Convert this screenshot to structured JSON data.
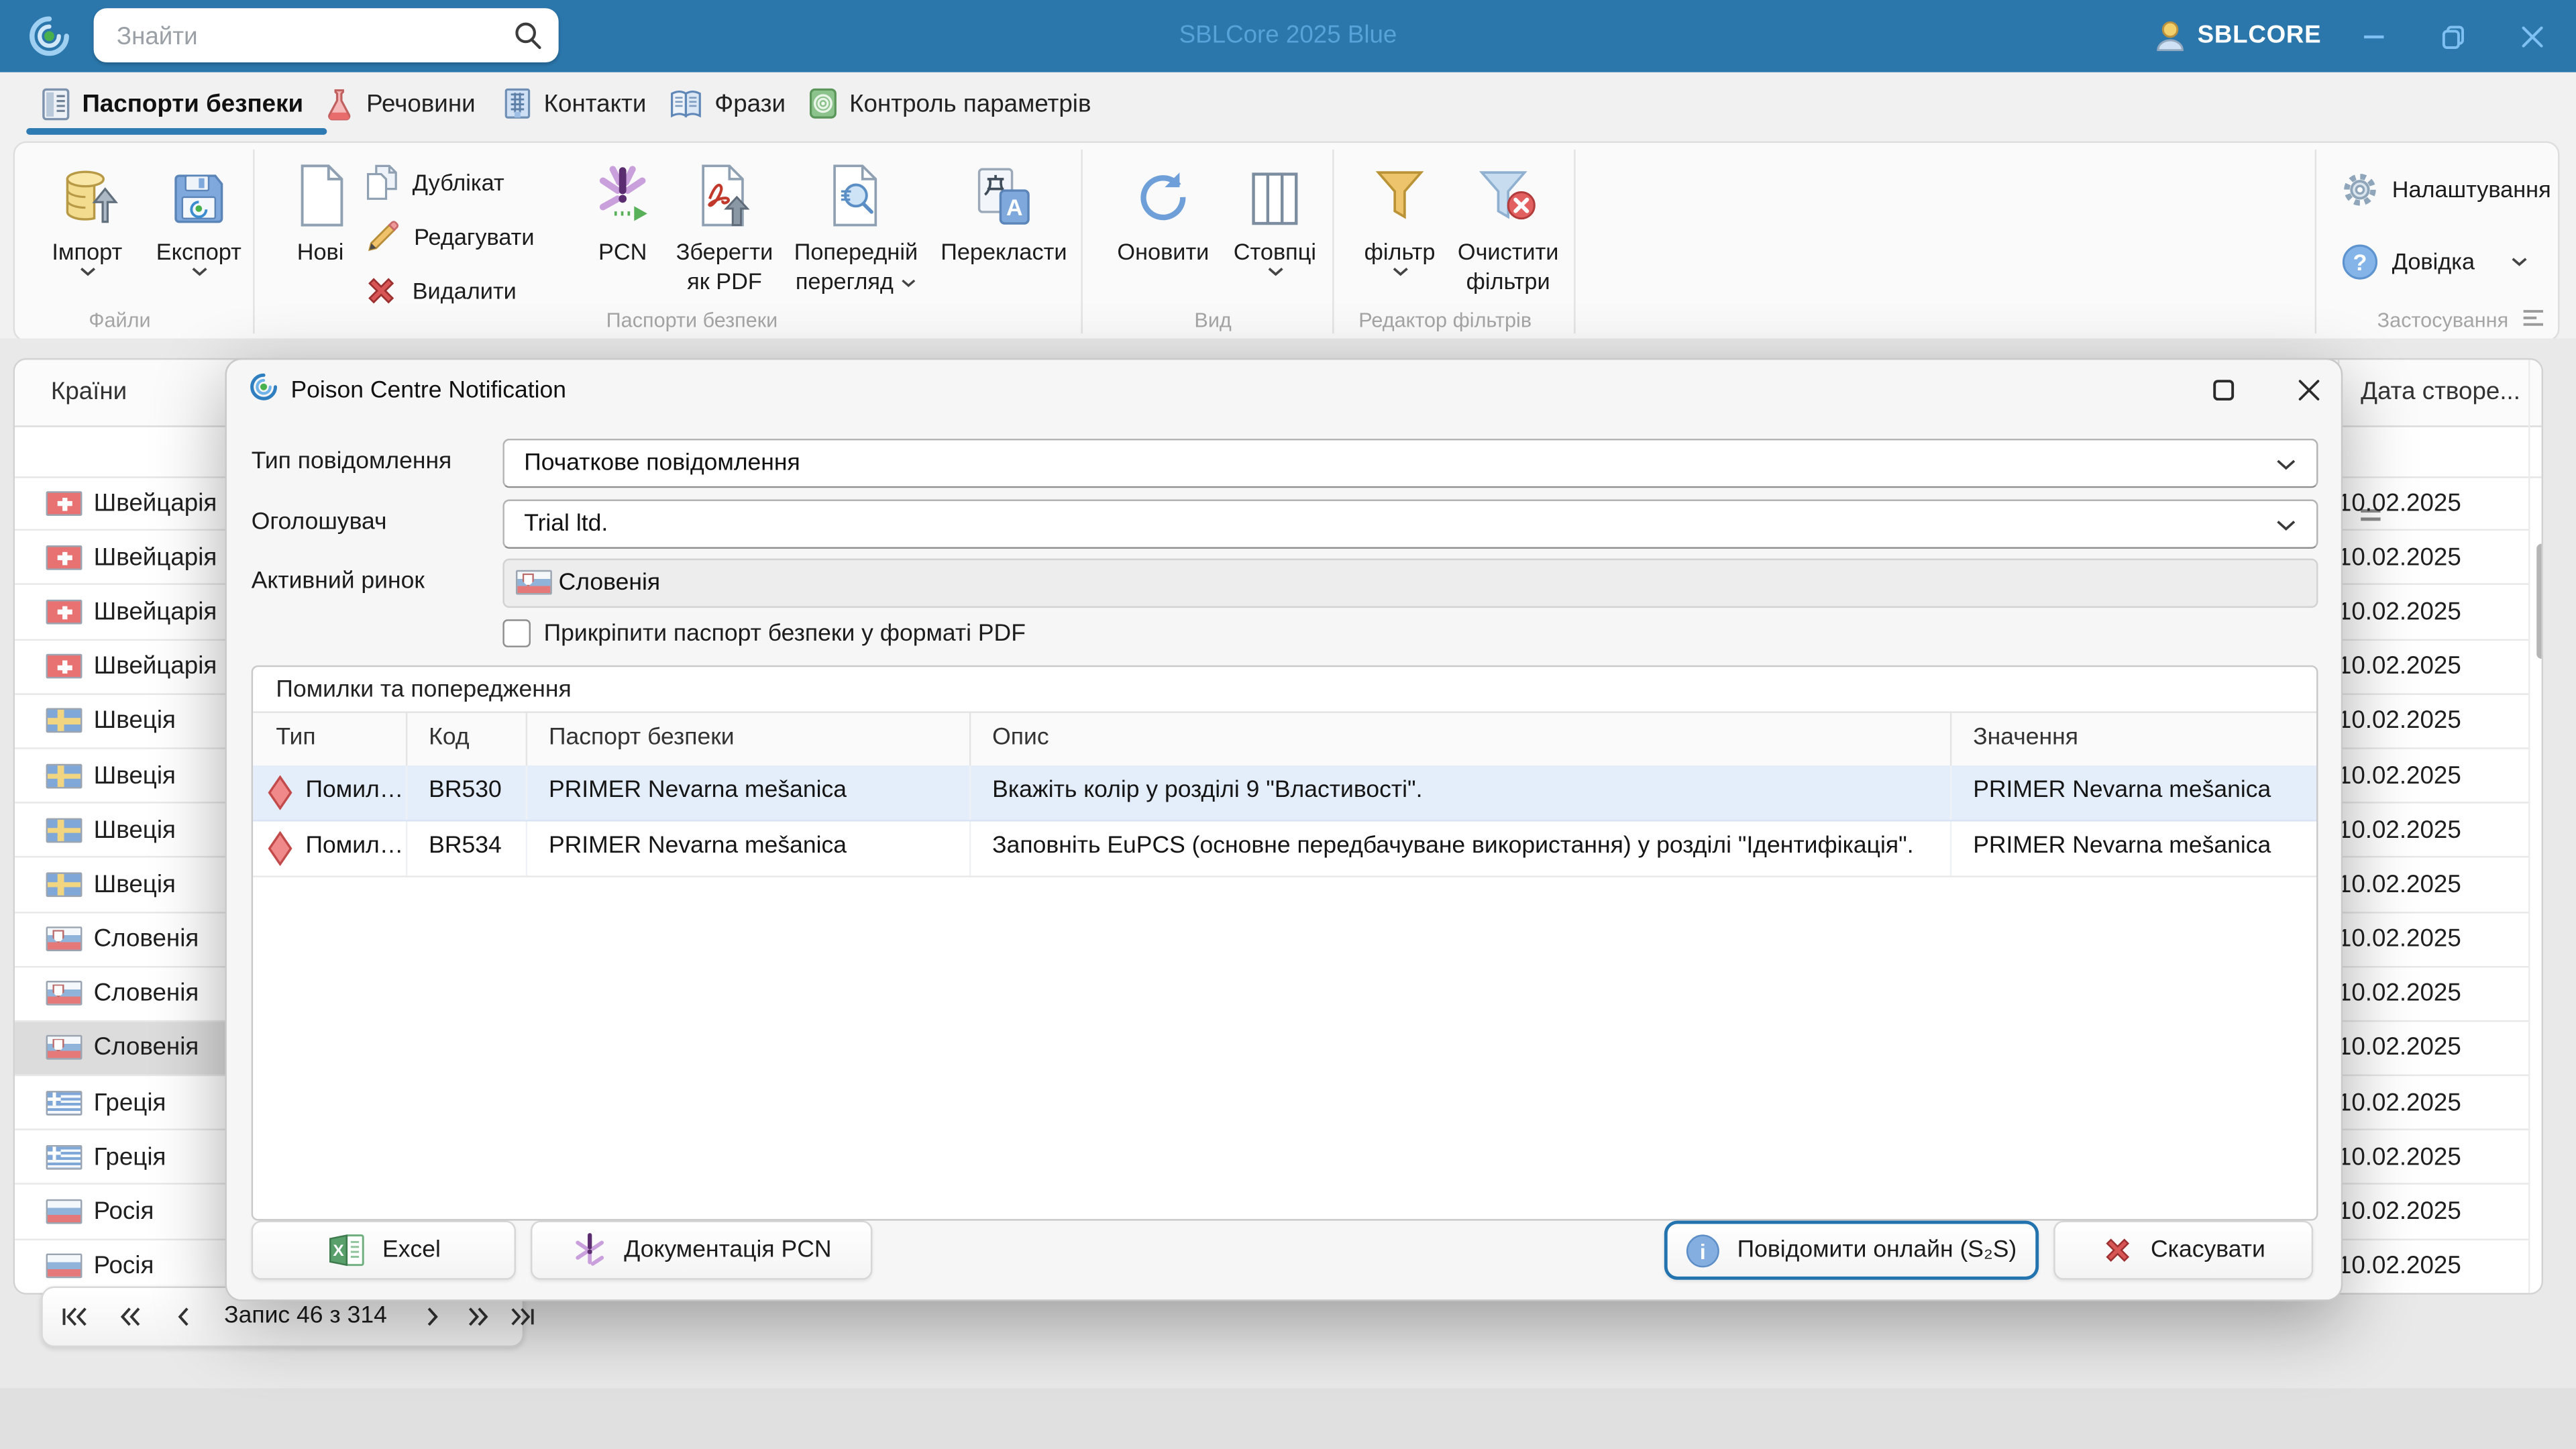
{
  "window": {
    "app_title": "SBLCore 2025 Blue",
    "search_placeholder": "Знайти",
    "user_label": "SBLCORE"
  },
  "tabs": [
    {
      "label": "Паспорти безпеки"
    },
    {
      "label": "Речовини"
    },
    {
      "label": "Контакти"
    },
    {
      "label": "Фрази"
    },
    {
      "label": "Контроль параметрів"
    }
  ],
  "ribbon": {
    "import": "Імпорт",
    "export": "Експорт",
    "files_group": "Файли",
    "new": "Нові",
    "duplicate": "Дублікат",
    "edit": "Редагувати",
    "delete": "Видалити",
    "pcn": "PCN",
    "save_pdf": "Зберегти як PDF",
    "preview": "Попередній перегляд",
    "translate": "Перекласти",
    "sds_group": "Паспорти безпеки",
    "refresh": "Оновити",
    "columns": "Стовпці",
    "view_group": "Вид",
    "filter": "фільтр",
    "clear_filters": "Очистити фільтри",
    "filter_editor_group": "Редактор фільтрів",
    "settings": "Налаштування",
    "help": "Довідка",
    "application_group": "Застосування"
  },
  "countries": {
    "header": "Країни",
    "rows": [
      {
        "flag": "ch",
        "name": "Швейцарія",
        "state": "normal"
      },
      {
        "flag": "ch",
        "name": "Швейцарія",
        "state": "normal"
      },
      {
        "flag": "ch",
        "name": "Швейцарія",
        "state": "normal"
      },
      {
        "flag": "ch",
        "name": "Швейцарія",
        "state": "normal"
      },
      {
        "flag": "se",
        "name": "Швеція",
        "state": "normal"
      },
      {
        "flag": "se",
        "name": "Швеція",
        "state": "normal"
      },
      {
        "flag": "se",
        "name": "Швеція",
        "state": "normal"
      },
      {
        "flag": "se",
        "name": "Швеція",
        "state": "normal"
      },
      {
        "flag": "si",
        "name": "Словенія",
        "state": "normal"
      },
      {
        "flag": "si",
        "name": "Словенія",
        "state": "normal"
      },
      {
        "flag": "si",
        "name": "Словенія",
        "state": "selected"
      },
      {
        "flag": "gr",
        "name": "Греція",
        "state": "normal"
      },
      {
        "flag": "gr",
        "name": "Греція",
        "state": "normal"
      },
      {
        "flag": "ru",
        "name": "Росія",
        "state": "normal"
      },
      {
        "flag": "ru",
        "name": "Росія",
        "state": "normal"
      }
    ],
    "pager_label": "Запис 46 з 314"
  },
  "dates": {
    "header": "Дата створе...",
    "rows": [
      "10.02.2025",
      "10.02.2025",
      "10.02.2025",
      "10.02.2025",
      "10.02.2025",
      "10.02.2025",
      "10.02.2025",
      "10.02.2025",
      "10.02.2025",
      "10.02.2025",
      "10.02.2025",
      "10.02.2025",
      "10.02.2025",
      "10.02.2025",
      "10.02.2025"
    ]
  },
  "dialog": {
    "title": "Poison Centre Notification",
    "type_label": "Тип повідомлення",
    "type_value": "Початкове повідомлення",
    "notifier_label": "Оголошувач",
    "notifier_value": "Trial ltd.",
    "market_label": "Активний ринок",
    "market_value": "Словенія",
    "attach_label": "Прикріпити паспорт безпеки у форматі PDF",
    "errors_title": "Помилки та попередження",
    "columns": [
      "Тип",
      "Код",
      "Паспорт безпеки",
      "Опис",
      "Значення"
    ],
    "rows": [
      {
        "type": "Помил…",
        "code": "BR530",
        "sds": "PRIMER Nevarna mešanica",
        "desc": "Вкажіть колір у розділі 9 \"Властивості\".",
        "value": "PRIMER Nevarna mešanica",
        "state": "selected"
      },
      {
        "type": "Помил…",
        "code": "BR534",
        "sds": "PRIMER Nevarna mešanica",
        "desc": "Заповніть EuPCS (основне передбачуване використання) у розділі \"Ідентифікація\".",
        "value": "PRIMER Nevarna mešanica",
        "state": "normal"
      }
    ],
    "excel": "Excel",
    "pcn_doc": "Документація PCN",
    "notify": "Повідомити онлайн (S₂S)",
    "cancel": "Скасувати"
  }
}
